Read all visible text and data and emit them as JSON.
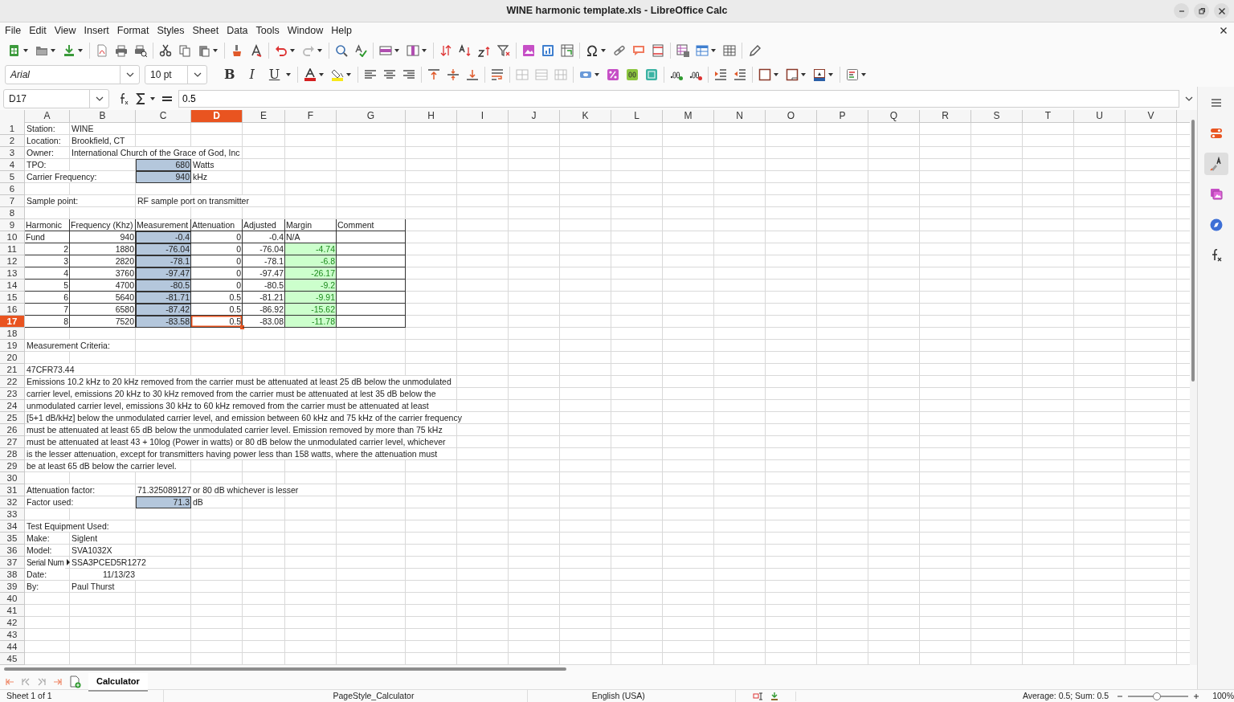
{
  "window": {
    "title": "WINE harmonic template.xls - LibreOffice Calc"
  },
  "menu": [
    "File",
    "Edit",
    "View",
    "Insert",
    "Format",
    "Styles",
    "Sheet",
    "Data",
    "Tools",
    "Window",
    "Help"
  ],
  "formatting_toolbar": {
    "font_name": "Arial",
    "font_size": "10 pt",
    "style_buttons": [
      "B",
      "I",
      "U"
    ]
  },
  "formula_bar": {
    "name_box": "D17",
    "formula": "0.5"
  },
  "columns": [
    {
      "label": "A",
      "selected": false
    },
    {
      "label": "B",
      "selected": false
    },
    {
      "label": "C",
      "selected": false
    },
    {
      "label": "D",
      "selected": true
    },
    {
      "label": "E",
      "selected": false
    },
    {
      "label": "F",
      "selected": false
    },
    {
      "label": "G",
      "selected": false
    },
    {
      "label": "H",
      "selected": false
    },
    {
      "label": "I",
      "selected": false
    },
    {
      "label": "J",
      "selected": false
    },
    {
      "label": "K",
      "selected": false
    },
    {
      "label": "L",
      "selected": false
    },
    {
      "label": "M",
      "selected": false
    },
    {
      "label": "N",
      "selected": false
    },
    {
      "label": "O",
      "selected": false
    },
    {
      "label": "P",
      "selected": false
    },
    {
      "label": "Q",
      "selected": false
    },
    {
      "label": "R",
      "selected": false
    },
    {
      "label": "S",
      "selected": false
    },
    {
      "label": "T",
      "selected": false
    },
    {
      "label": "U",
      "selected": false
    },
    {
      "label": "V",
      "selected": false
    }
  ],
  "rows": [
    {
      "number": "1",
      "selected": false,
      "cells": [
        {
          "text": "Station:",
          "kind": "text",
          "selected": false
        },
        {
          "text": "WINE",
          "kind": "text",
          "selected": false
        }
      ]
    },
    {
      "number": "2",
      "selected": false,
      "cells": [
        {
          "text": "Location:",
          "kind": "text",
          "selected": false
        },
        {
          "text": "Brookfield, CT",
          "kind": "text",
          "selected": false
        }
      ]
    },
    {
      "number": "3",
      "selected": false,
      "cells": [
        {
          "text": "Owner:",
          "kind": "text",
          "selected": false
        },
        {
          "text": "International Church of the Grace of God, Inc",
          "kind": "text",
          "selected": false
        }
      ]
    },
    {
      "number": "4",
      "selected": false,
      "cells": [
        {
          "text": "TPO:",
          "kind": "text",
          "selected": false
        },
        null,
        {
          "text": "680",
          "kind": "input",
          "selected": false
        },
        {
          "text": "Watts",
          "kind": "text",
          "selected": false
        }
      ]
    },
    {
      "number": "5",
      "selected": false,
      "cells": [
        {
          "text": "Carrier Frequency:",
          "kind": "text",
          "selected": false
        },
        null,
        {
          "text": "940",
          "kind": "input",
          "selected": false
        },
        {
          "text": "kHz",
          "kind": "text",
          "selected": false
        }
      ]
    },
    {
      "number": "6",
      "selected": false,
      "cells": []
    },
    {
      "number": "7",
      "selected": false,
      "cells": [
        {
          "text": "Sample point:",
          "kind": "text",
          "selected": false
        },
        null,
        {
          "text": "RF sample port on transmitter",
          "kind": "text",
          "selected": false
        }
      ]
    },
    {
      "number": "8",
      "selected": false,
      "cells": []
    },
    {
      "number": "9",
      "selected": false,
      "bordered": true,
      "cells": [
        {
          "text": "Harmonic",
          "kind": "text",
          "selected": false
        },
        {
          "text": "Frequency (Khz)",
          "kind": "text",
          "selected": false
        },
        {
          "text": "Measurement",
          "kind": "text",
          "selected": false
        },
        {
          "text": "Attenuation",
          "kind": "text",
          "selected": false
        },
        {
          "text": "Adjusted",
          "kind": "text",
          "selected": false
        },
        {
          "text": "Margin",
          "kind": "text",
          "selected": false
        },
        {
          "text": "Comment",
          "kind": "text",
          "selected": false
        }
      ]
    },
    {
      "number": "10",
      "selected": false,
      "bordered": true,
      "cells": [
        {
          "text": "Fund",
          "kind": "text",
          "selected": false
        },
        {
          "text": "940",
          "kind": "number",
          "selected": false
        },
        {
          "text": "-0.4",
          "kind": "input",
          "selected": false
        },
        {
          "text": "0",
          "kind": "number",
          "selected": false
        },
        {
          "text": "-0.4",
          "kind": "number",
          "selected": false
        },
        {
          "text": "N/A",
          "kind": "text",
          "selected": false
        }
      ]
    },
    {
      "number": "11",
      "selected": false,
      "bordered": true,
      "cells": [
        {
          "text": "2",
          "kind": "number",
          "selected": false
        },
        {
          "text": "1880",
          "kind": "number",
          "selected": false
        },
        {
          "text": "-76.04",
          "kind": "input",
          "selected": false
        },
        {
          "text": "0",
          "kind": "number",
          "selected": false
        },
        {
          "text": "-76.04",
          "kind": "number",
          "selected": false
        },
        {
          "text": "-4.74",
          "kind": "margin",
          "selected": false
        }
      ]
    },
    {
      "number": "12",
      "selected": false,
      "bordered": true,
      "cells": [
        {
          "text": "3",
          "kind": "number",
          "selected": false
        },
        {
          "text": "2820",
          "kind": "number",
          "selected": false
        },
        {
          "text": "-78.1",
          "kind": "input",
          "selected": false
        },
        {
          "text": "0",
          "kind": "number",
          "selected": false
        },
        {
          "text": "-78.1",
          "kind": "number",
          "selected": false
        },
        {
          "text": "-6.8",
          "kind": "margin",
          "selected": false
        }
      ]
    },
    {
      "number": "13",
      "selected": false,
      "bordered": true,
      "cells": [
        {
          "text": "4",
          "kind": "number",
          "selected": false
        },
        {
          "text": "3760",
          "kind": "number",
          "selected": false
        },
        {
          "text": "-97.47",
          "kind": "input",
          "selected": false
        },
        {
          "text": "0",
          "kind": "number",
          "selected": false
        },
        {
          "text": "-97.47",
          "kind": "number",
          "selected": false
        },
        {
          "text": "-26.17",
          "kind": "margin",
          "selected": false
        }
      ]
    },
    {
      "number": "14",
      "selected": false,
      "bordered": true,
      "cells": [
        {
          "text": "5",
          "kind": "number",
          "selected": false
        },
        {
          "text": "4700",
          "kind": "number",
          "selected": false
        },
        {
          "text": "-80.5",
          "kind": "input",
          "selected": false
        },
        {
          "text": "0",
          "kind": "number",
          "selected": false
        },
        {
          "text": "-80.5",
          "kind": "number",
          "selected": false
        },
        {
          "text": "-9.2",
          "kind": "margin",
          "selected": false
        }
      ]
    },
    {
      "number": "15",
      "selected": false,
      "bordered": true,
      "cells": [
        {
          "text": "6",
          "kind": "number",
          "selected": false
        },
        {
          "text": "5640",
          "kind": "number",
          "selected": false
        },
        {
          "text": "-81.71",
          "kind": "input",
          "selected": false
        },
        {
          "text": "0.5",
          "kind": "number",
          "selected": false
        },
        {
          "text": "-81.21",
          "kind": "number",
          "selected": false
        },
        {
          "text": "-9.91",
          "kind": "margin",
          "selected": false
        }
      ]
    },
    {
      "number": "16",
      "selected": false,
      "bordered": true,
      "cells": [
        {
          "text": "7",
          "kind": "number",
          "selected": false
        },
        {
          "text": "6580",
          "kind": "number",
          "selected": false
        },
        {
          "text": "-87.42",
          "kind": "input",
          "selected": false
        },
        {
          "text": "0.5",
          "kind": "number",
          "selected": false
        },
        {
          "text": "-86.92",
          "kind": "number",
          "selected": false
        },
        {
          "text": "-15.62",
          "kind": "margin",
          "selected": false
        }
      ]
    },
    {
      "number": "17",
      "selected": true,
      "bordered": true,
      "cells": [
        {
          "text": "8",
          "kind": "number",
          "selected": false
        },
        {
          "text": "7520",
          "kind": "number",
          "selected": false
        },
        {
          "text": "-83.58",
          "kind": "input",
          "selected": false
        },
        {
          "text": "0.5",
          "kind": "number",
          "selected": true
        },
        {
          "text": "-83.08",
          "kind": "number",
          "selected": false
        },
        {
          "text": "-11.78",
          "kind": "margin",
          "selected": false
        }
      ]
    },
    {
      "number": "18",
      "selected": false,
      "cells": []
    },
    {
      "number": "19",
      "selected": false,
      "cells": [
        {
          "text": "Measurement Criteria:",
          "kind": "text",
          "selected": false
        }
      ]
    },
    {
      "number": "20",
      "selected": false,
      "cells": []
    },
    {
      "number": "21",
      "selected": false,
      "cells": [
        {
          "text": "47CFR73.44",
          "kind": "text",
          "selected": false
        }
      ]
    },
    {
      "number": "22",
      "selected": false,
      "cells": [
        {
          "text": "Emissions 10.2 kHz to 20 kHz removed from the carrier must be attenuated at least 25 dB below the unmodulated",
          "kind": "text",
          "selected": false
        }
      ]
    },
    {
      "number": "23",
      "selected": false,
      "cells": [
        {
          "text": "carrier level, emissions 20 kHz to 30 kHz removed from the carrier must be attenuated at lest 35 dB below the",
          "kind": "text",
          "selected": false
        }
      ]
    },
    {
      "number": "24",
      "selected": false,
      "cells": [
        {
          "text": "unmodulated carrier level, emissions 30 kHz to 60 kHz removed from the carrier must be attenuated at least",
          "kind": "text",
          "selected": false
        }
      ]
    },
    {
      "number": "25",
      "selected": false,
      "cells": [
        {
          "text": "[5+1 dB/kHz] below the unmodulated carrier level, and emission between 60 kHz and 75 kHz of the carrier frequency",
          "kind": "text",
          "selected": false
        }
      ]
    },
    {
      "number": "26",
      "selected": false,
      "cells": [
        {
          "text": "must be attenuated at least 65 dB below the unmodulated carrier level.  Emission removed by more than 75 kHz",
          "kind": "text",
          "selected": false
        }
      ]
    },
    {
      "number": "27",
      "selected": false,
      "cells": [
        {
          "text": "must be attenuated at least 43 + 10log (Power in watts) or 80 dB below the unmodulated carrier level, whichever",
          "kind": "text",
          "selected": false
        }
      ]
    },
    {
      "number": "28",
      "selected": false,
      "cells": [
        {
          "text": "is the lesser attenuation, except for transmitters having power less than 158 watts, where the attenuation must",
          "kind": "text",
          "selected": false
        }
      ]
    },
    {
      "number": "29",
      "selected": false,
      "cells": [
        {
          "text": "be at least 65 dB below the carrier level.",
          "kind": "text",
          "selected": false
        }
      ]
    },
    {
      "number": "30",
      "selected": false,
      "cells": []
    },
    {
      "number": "31",
      "selected": false,
      "cells": [
        {
          "text": "Attenuation factor:",
          "kind": "text",
          "selected": false
        },
        null,
        {
          "text": "71.325089127",
          "kind": "text",
          "selected": false
        },
        {
          "text": "or 80 dB whichever is lesser",
          "kind": "text",
          "selected": false
        }
      ]
    },
    {
      "number": "32",
      "selected": false,
      "cells": [
        {
          "text": "Factor used:",
          "kind": "text",
          "selected": false
        },
        null,
        {
          "text": "71.3",
          "kind": "input",
          "selected": false
        },
        {
          "text": "dB",
          "kind": "text",
          "selected": false
        }
      ]
    },
    {
      "number": "33",
      "selected": false,
      "cells": []
    },
    {
      "number": "34",
      "selected": false,
      "cells": [
        {
          "text": "Test Equipment Used:",
          "kind": "text",
          "selected": false
        }
      ]
    },
    {
      "number": "35",
      "selected": false,
      "cells": [
        {
          "text": "Make:",
          "kind": "text",
          "selected": false
        },
        {
          "text": "Siglent",
          "kind": "text",
          "selected": false
        }
      ]
    },
    {
      "number": "36",
      "selected": false,
      "cells": [
        {
          "text": "Model:",
          "kind": "text",
          "selected": false
        },
        {
          "text": "SVA1032X",
          "kind": "text",
          "selected": false
        }
      ]
    },
    {
      "number": "37",
      "selected": false,
      "cells": [
        {
          "text": "Serial Num",
          "kind": "text",
          "clipped": true,
          "selected": false
        },
        {
          "text": "SSA3PCED5R1272",
          "kind": "text",
          "selected": false
        }
      ]
    },
    {
      "number": "38",
      "selected": false,
      "cells": [
        {
          "text": "Date:",
          "kind": "text",
          "selected": false
        },
        {
          "text": "11/13/23",
          "kind": "number",
          "selected": false
        }
      ]
    },
    {
      "number": "39",
      "selected": false,
      "cells": [
        {
          "text": "By:",
          "kind": "text",
          "selected": false
        },
        {
          "text": "Paul Thurst",
          "kind": "text",
          "selected": false
        }
      ]
    },
    {
      "number": "40",
      "selected": false,
      "cells": []
    },
    {
      "number": "41",
      "selected": false,
      "cells": []
    },
    {
      "number": "42",
      "selected": false,
      "cells": []
    },
    {
      "number": "43",
      "selected": false,
      "cells": []
    },
    {
      "number": "44",
      "selected": false,
      "cells": []
    },
    {
      "number": "45",
      "selected": false,
      "cells": []
    }
  ],
  "sheet_tabs": [
    {
      "label": "Calculator",
      "selected": true
    }
  ],
  "status_bar": {
    "sheet": "Sheet 1 of 1",
    "page_style": "PageStyle_Calculator",
    "language": "English (USA)",
    "selection_summary": "Average: 0.5; Sum: 0.5",
    "zoom": {
      "level": 0.48,
      "reading": "100%"
    }
  }
}
